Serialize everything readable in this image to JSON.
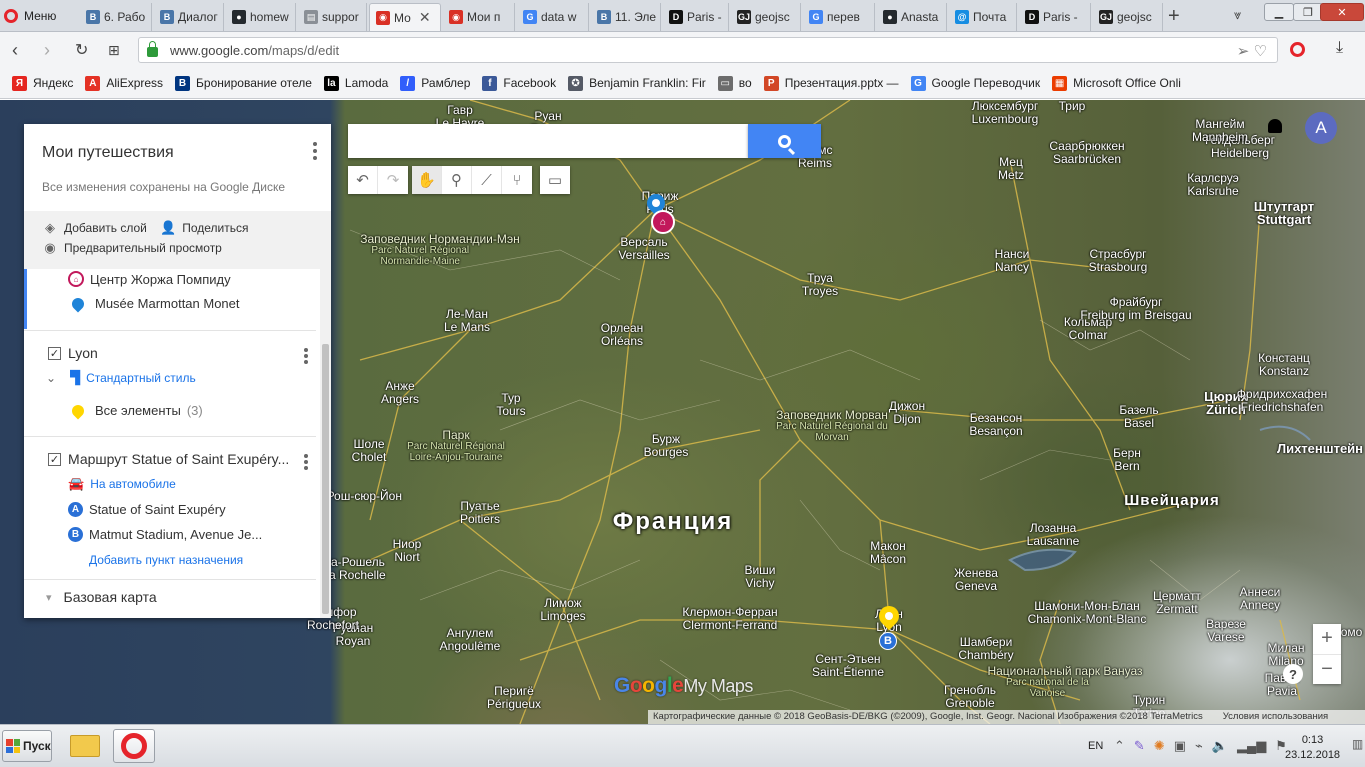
{
  "browser": {
    "menu_label": "Меню",
    "tabs": [
      {
        "label": "6. Рабо",
        "icon": "vk-icon",
        "color": "#4a76a8"
      },
      {
        "label": "Диалог",
        "icon": "vk-icon",
        "color": "#4a76a8"
      },
      {
        "label": "homew",
        "icon": "github-icon",
        "color": "#24292e"
      },
      {
        "label": "suppor",
        "icon": "document-icon",
        "color": "#8a8f96"
      },
      {
        "label": "Мо",
        "icon": "mymaps-icon",
        "color": "#d93025",
        "active": true
      },
      {
        "label": "Мои п",
        "icon": "mymaps-icon",
        "color": "#d93025"
      },
      {
        "label": "data w",
        "icon": "google-icon",
        "color": "#4285f4"
      },
      {
        "label": "11. Эле",
        "icon": "vk-icon",
        "color": "#4a76a8"
      },
      {
        "label": "Paris -",
        "icon": "d-icon",
        "color": "#111111"
      },
      {
        "label": "geojsc",
        "icon": "geojson-icon",
        "color": "#222222"
      },
      {
        "label": "перев",
        "icon": "google-icon",
        "color": "#4285f4"
      },
      {
        "label": "Anasta",
        "icon": "github-icon",
        "color": "#24292e"
      },
      {
        "label": "Почта",
        "icon": "mail-icon",
        "color": "#168de2"
      },
      {
        "label": "Paris -",
        "icon": "d-icon",
        "color": "#111111"
      },
      {
        "label": "geojsc",
        "icon": "geojson-icon",
        "color": "#222222"
      }
    ],
    "tab_close": "✕",
    "new_tab": "+",
    "url_host": "www.google.com",
    "url_path": "/maps/d/edit"
  },
  "bookmarks": [
    {
      "label": "Яндекс",
      "icon": "yandex-icon",
      "color": "#e52620"
    },
    {
      "label": "AliExpress",
      "icon": "aliexpress-icon",
      "color": "#e43225"
    },
    {
      "label": "Бронирование отеле",
      "icon": "booking-icon",
      "color": "#003580"
    },
    {
      "label": "Lamoda",
      "icon": "lamoda-icon",
      "color": "#000000"
    },
    {
      "label": "Рамблер",
      "icon": "rambler-icon",
      "color": "#315efb"
    },
    {
      "label": "Facebook",
      "icon": "facebook-icon",
      "color": "#3b5998"
    },
    {
      "label": "Benjamin Franklin: Fir",
      "icon": "seal-icon",
      "color": "#555a66"
    },
    {
      "label": "во",
      "icon": "folder-icon",
      "color": "#6c6c6c"
    },
    {
      "label": "Презентация.pptx —",
      "icon": "powerpoint-icon",
      "color": "#d24726"
    },
    {
      "label": "Google Переводчик",
      "icon": "translate-icon",
      "color": "#4285f4"
    },
    {
      "label": "Microsoft Office Onli",
      "icon": "office-icon",
      "color": "#eb3c00"
    }
  ],
  "panel": {
    "title": "Мои путешествия",
    "subtitle": "Все изменения сохранены на Google Диске",
    "actions": {
      "add_layer": "Добавить слой",
      "share": "Поделиться",
      "preview": "Предварительный просмотр"
    },
    "places": [
      {
        "label": "Центр Жоржа Помпиду",
        "icon": "museum-icon"
      },
      {
        "label": "Musée Marmottan Monet",
        "icon": "pin-icon"
      }
    ],
    "lyon_layer": {
      "name": "Lyon",
      "style_label": "Стандартный стиль",
      "all_items": "Все элементы",
      "count": "(3)"
    },
    "route_layer": {
      "name": "Маршрут Statue of Saint Exupéry...",
      "mode": "На автомобиле",
      "stop_a_letter": "A",
      "stop_a": "Statue of Saint Exupéry",
      "stop_b_letter": "B",
      "stop_b": "Matmut Stadium, Avenue Je...",
      "add_destination": "Добавить пункт назначения"
    },
    "base_map": "Базовая карта"
  },
  "map": {
    "search_placeholder": "",
    "avatar_letter": "A",
    "logo_google": [
      "G",
      "o",
      "o",
      "g",
      "l",
      "e"
    ],
    "logo_mymaps": "My Maps",
    "country_label": "Франция",
    "switzerland_label": "Швейцария",
    "attribution": "Картографические данные © 2018 GeoBasis-DE/BKG (©2009), Google, Inst. Geogr. Nacional Изображения ©2018 TerraMetrics",
    "terms": "Условия использования",
    "zoom_in": "+",
    "zoom_out": "−",
    "help": "?",
    "places": [
      {
        "ru": "Гавр",
        "en": "Le Havre"
      },
      {
        "ru": "Руан",
        "en": "Rouen"
      },
      {
        "ru": "Реймс",
        "en": "Reims"
      },
      {
        "ru": "Париж",
        "en": "Paris"
      },
      {
        "ru": "Версаль",
        "en": "Versailles"
      },
      {
        "ru": "Мец",
        "en": "Metz"
      },
      {
        "ru": "Саарбрюккен",
        "en": "Saarbrücken"
      },
      {
        "ru": "Гейдельберг",
        "en": "Heidelberg"
      },
      {
        "ru": "Мангейм",
        "en": "Mannheim"
      },
      {
        "ru": "Карлсруэ",
        "en": "Karlsruhe"
      },
      {
        "ru": "Штутгарт",
        "en": "Stuttgart"
      },
      {
        "ru": "Нанси",
        "en": "Nancy"
      },
      {
        "ru": "Страсбург",
        "en": "Strasbourg"
      },
      {
        "ru": "Труа",
        "en": "Troyes"
      },
      {
        "ru": "Ле-Ман",
        "en": "Le Mans"
      },
      {
        "ru": "Орлеан",
        "en": "Orléans"
      },
      {
        "ru": "Кольмар",
        "en": "Colmar"
      },
      {
        "ru": "Фрайбург",
        "en": "Freiburg im Breisgau"
      },
      {
        "ru": "Анже",
        "en": "Angers"
      },
      {
        "ru": "Тур",
        "en": "Tours"
      },
      {
        "ru": "Дижон",
        "en": "Dijon"
      },
      {
        "ru": "Безансон",
        "en": "Besançon"
      },
      {
        "ru": "Базель",
        "en": "Basel"
      },
      {
        "ru": "Цюрих",
        "en": "Zürich"
      },
      {
        "ru": "Констанц",
        "en": "Konstanz"
      },
      {
        "ru": "Фридрихсхафен",
        "en": "Friedrichshafen"
      },
      {
        "ru": "Шоле",
        "en": "Cholet"
      },
      {
        "ru": "Бурж",
        "en": "Bourges"
      },
      {
        "ru": "Берн",
        "en": "Bern"
      },
      {
        "ru": "Лихтенштейн",
        "en": ""
      },
      {
        "ru": "Пуатье",
        "en": "Poitiers"
      },
      {
        "ru": "Лозанна",
        "en": "Lausanne"
      },
      {
        "ru": "Ниор",
        "en": "Niort"
      },
      {
        "ru": "Макон",
        "en": "Mâcon"
      },
      {
        "ru": "Виши",
        "en": "Vichy"
      },
      {
        "ru": "Женева",
        "en": "Geneva"
      },
      {
        "ru": "Лимож",
        "en": "Limoges"
      },
      {
        "ru": "Клермон-Ферран",
        "en": "Clermont-Ferrand"
      },
      {
        "ru": "Лион",
        "en": "Lyon"
      },
      {
        "ru": "Аннеси",
        "en": "Annecy"
      },
      {
        "ru": "Шамони-Мон-Блан",
        "en": "Chamonix-Mont-Blanc"
      },
      {
        "ru": "Церматт",
        "en": "Zermatt"
      },
      {
        "ru": "Варезе",
        "en": "Varese"
      },
      {
        "ru": "Ангулем",
        "en": "Angoulême"
      },
      {
        "ru": "Сент-Этьен",
        "en": "Saint-Étienne"
      },
      {
        "ru": "Шамбери",
        "en": "Chambéry"
      },
      {
        "ru": "Милан",
        "en": "Milano"
      },
      {
        "ru": "Ла-Рошель",
        "en": "La Rochelle"
      },
      {
        "ru": "Руайан",
        "en": "Royan"
      },
      {
        "ru": "Перигё",
        "en": "Périgueux"
      },
      {
        "ru": "Гренобль",
        "en": "Grenoble"
      },
      {
        "ru": "Турин",
        "en": "Torino"
      },
      {
        "ru": "Павия",
        "en": "Pavia"
      },
      {
        "ru": "Комо",
        "en": ""
      },
      {
        "ru": "Рошфор",
        "en": "Rochefort"
      },
      {
        "ru": "Люксембург",
        "en": "Luxembourg"
      },
      {
        "ru": "Трир",
        "en": ""
      },
      {
        "ru": "Ла-Рош-сюр-Йон",
        "en": ""
      }
    ],
    "regions": [
      {
        "ru": "Заповедник Нормандии-Мэн",
        "en": "Parc Naturel Régional Normandie-Maine"
      },
      {
        "ru": "Заповедник Морван",
        "en": "Parc Naturel Régional du Morvan"
      },
      {
        "ru": "Парк",
        "en": "Parc Naturel Régional Loire-Anjou-Touraine"
      },
      {
        "ru": "Национальный парк Вануаз",
        "en": "Parc national de la Vanoise"
      }
    ]
  },
  "taskbar": {
    "start_label": "Пуск",
    "lang": "EN",
    "time": "0:13",
    "date": "23.12.2018"
  }
}
